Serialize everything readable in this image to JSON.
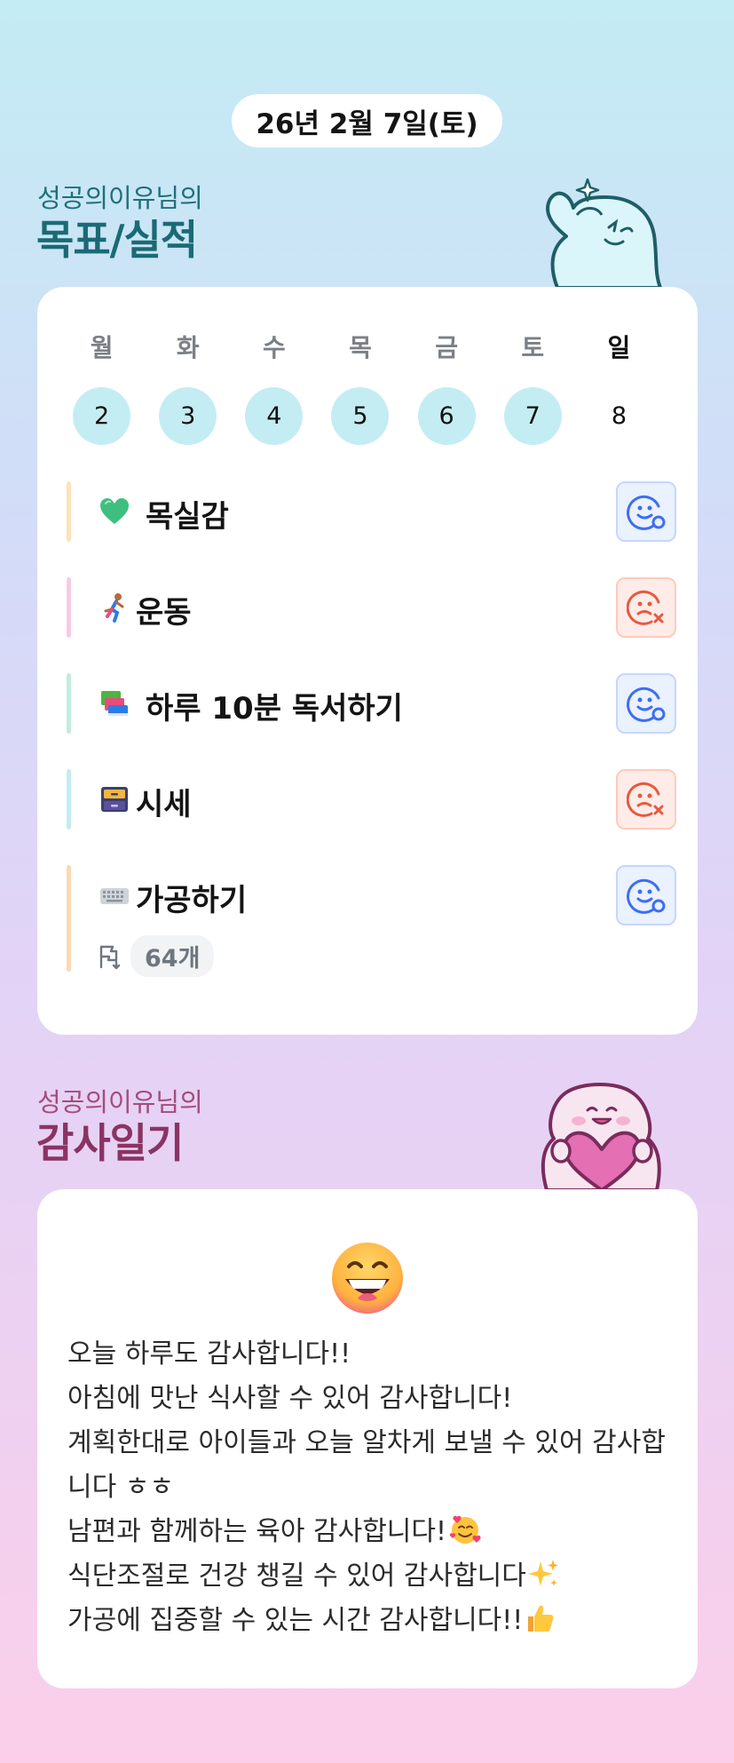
{
  "date": "26년 2월 7일(토)",
  "goals_section": {
    "subtitle": "성공의이유님의",
    "title": "목표/실적"
  },
  "week": {
    "days": [
      "월",
      "화",
      "수",
      "목",
      "금",
      "토",
      "일"
    ],
    "dates": [
      "2",
      "3",
      "4",
      "5",
      "6",
      "7",
      "8"
    ]
  },
  "goals": [
    {
      "emoji": "green-heart-icon",
      "label": "목실감",
      "status": "success"
    },
    {
      "emoji": "runner-icon",
      "label": "운동",
      "status": "fail"
    },
    {
      "emoji": "books-icon",
      "label": "하루 10분 독서하기",
      "status": "success"
    },
    {
      "emoji": "file-cabinet-icon",
      "label": "시세",
      "status": "fail"
    },
    {
      "emoji": "keyboard-icon",
      "label": "가공하기",
      "status": "success",
      "count": "64개"
    }
  ],
  "gratitude_section": {
    "subtitle": "성공의이유님의",
    "title": "감사일기",
    "mood_icon": "grinning-face-icon",
    "lines": [
      "오늘 하루도 감사합니다!!",
      "아침에 맛난 식사할 수 있어 감사합니다!",
      "계획한대로 아이들과 오늘 알차게 보낼 수 있어 감사합니다 ㅎㅎ",
      "남편과 함께하는 육아 감사합니다!",
      "식단조절로 건강 챙길 수 있어 감사합니다",
      "가공에 집중할 수 있는 시간 감사합니다!!"
    ],
    "line_emojis": [
      "smiling-hearts-icon",
      "sparkles-icon",
      "thumbs-up-icon"
    ]
  },
  "colors": {
    "goal_teal": "#1f6f78",
    "diary_plum": "#8a3364",
    "success_blue": "#3e6ef0",
    "fail_red": "#e55a3f"
  }
}
